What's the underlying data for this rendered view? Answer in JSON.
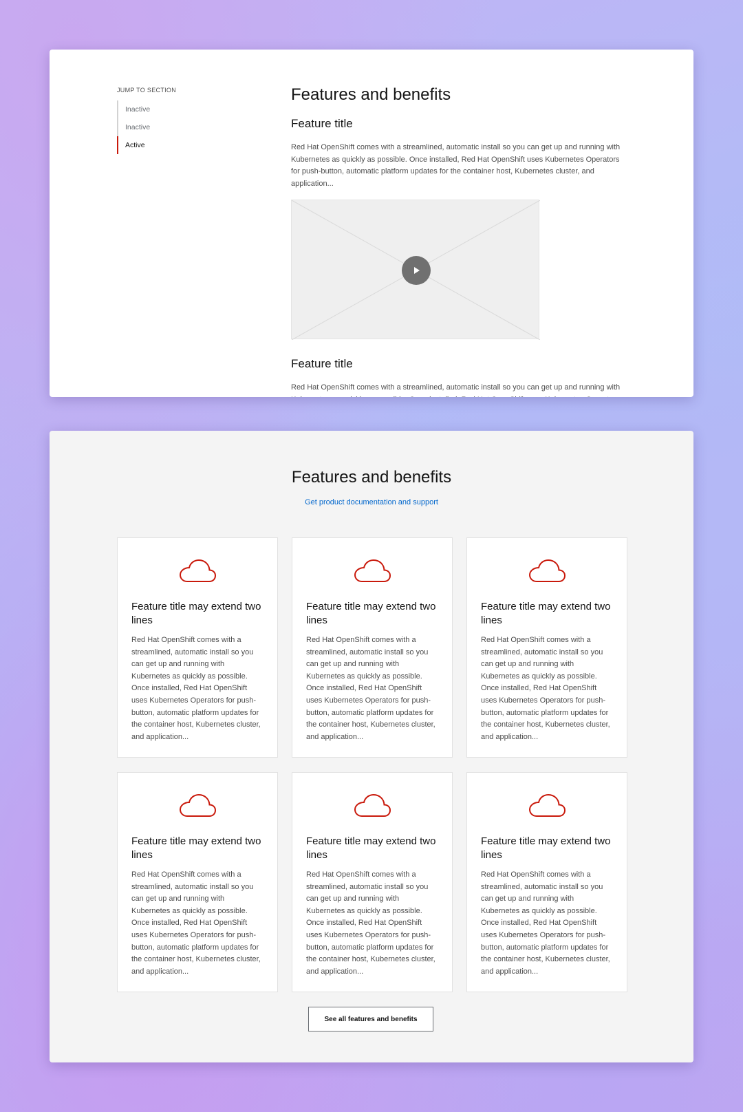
{
  "colors": {
    "accent_red": "#c9190b",
    "link_blue": "#0066cc",
    "text_dark": "#151515",
    "text_body": "#4d4d4d"
  },
  "top_section": {
    "jump_label": "JUMP TO SECTION",
    "jump_items": [
      {
        "label": "Inactive",
        "state": "inactive"
      },
      {
        "label": "Inactive",
        "state": "inactive"
      },
      {
        "label": "Active",
        "state": "active"
      }
    ],
    "heading": "Features and benefits",
    "features": [
      {
        "title": "Feature title",
        "body": "Red Hat OpenShift comes with a streamlined, automatic install so you can get up and running with Kubernetes as quickly as possible. Once installed, Red Hat OpenShift uses Kubernetes Operators for push-button, automatic platform updates for the container host, Kubernetes cluster, and application..."
      },
      {
        "title": "Feature title",
        "body": "Red Hat OpenShift comes with a streamlined, automatic install so you can get up and running with Kubernetes as quickly as possible. Once installed, Red Hat OpenShift uses Kubernetes Operators for push-button, automatic platform updates for the container host, Kubernetes cluster, and application..."
      }
    ],
    "video_icon": "play-icon"
  },
  "bottom_section": {
    "heading": "Features and benefits",
    "link": "Get product documentation and support",
    "card_icon": "cloud-icon",
    "cards": [
      {
        "title": "Feature title may extend two lines",
        "body": "Red Hat OpenShift comes with a streamlined, automatic install so you can get up and running with Kubernetes as quickly as possible. Once installed, Red Hat OpenShift uses Kubernetes Operators for push-button, automatic platform updates for the container host, Kubernetes cluster, and application..."
      },
      {
        "title": "Feature title may extend two lines",
        "body": "Red Hat OpenShift comes with a streamlined, automatic install so you can get up and running with Kubernetes as quickly as possible. Once installed, Red Hat OpenShift uses Kubernetes Operators for push-button, automatic platform updates for the container host, Kubernetes cluster, and application..."
      },
      {
        "title": "Feature title may extend two lines",
        "body": "Red Hat OpenShift comes with a streamlined, automatic install so you can get up and running with Kubernetes as quickly as possible. Once installed, Red Hat OpenShift uses Kubernetes Operators for push-button, automatic platform updates for the container host, Kubernetes cluster, and application..."
      },
      {
        "title": "Feature title may extend two lines",
        "body": "Red Hat OpenShift comes with a streamlined, automatic install so you can get up and running with Kubernetes as quickly as possible. Once installed, Red Hat OpenShift uses Kubernetes Operators for push-button, automatic platform updates for the container host, Kubernetes cluster, and application..."
      },
      {
        "title": "Feature title may extend two lines",
        "body": "Red Hat OpenShift comes with a streamlined, automatic install so you can get up and running with Kubernetes as quickly as possible. Once installed, Red Hat OpenShift uses Kubernetes Operators for push-button, automatic platform updates for the container host, Kubernetes cluster, and application..."
      },
      {
        "title": "Feature title may extend two lines",
        "body": "Red Hat OpenShift comes with a streamlined, automatic install so you can get up and running with Kubernetes as quickly as possible. Once installed, Red Hat OpenShift uses Kubernetes Operators for push-button, automatic platform updates for the container host, Kubernetes cluster, and application..."
      }
    ],
    "button_label": "See all features and benefits"
  }
}
